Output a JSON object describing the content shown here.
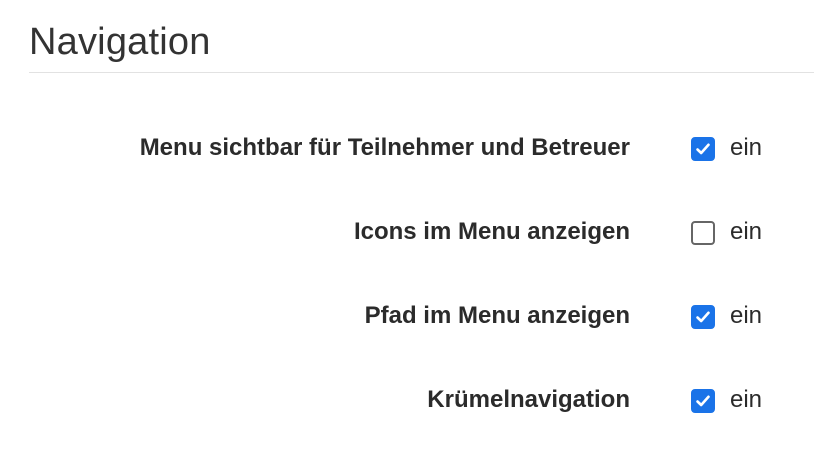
{
  "section": {
    "title": "Navigation"
  },
  "rows": [
    {
      "label": "Menu sichtbar für Teilnehmer und Betreuer",
      "checked": true,
      "option_label": "ein"
    },
    {
      "label": "Icons im Menu anzeigen",
      "checked": false,
      "option_label": "ein"
    },
    {
      "label": "Pfad im Menu anzeigen",
      "checked": true,
      "option_label": "ein"
    },
    {
      "label": "Krümelnavigation",
      "checked": true,
      "option_label": "ein"
    }
  ],
  "colors": {
    "accent": "#1a73e8",
    "text": "#2b2b2b",
    "divider": "#e2e2e2"
  },
  "icons": {
    "checked": "checkmark-icon"
  }
}
